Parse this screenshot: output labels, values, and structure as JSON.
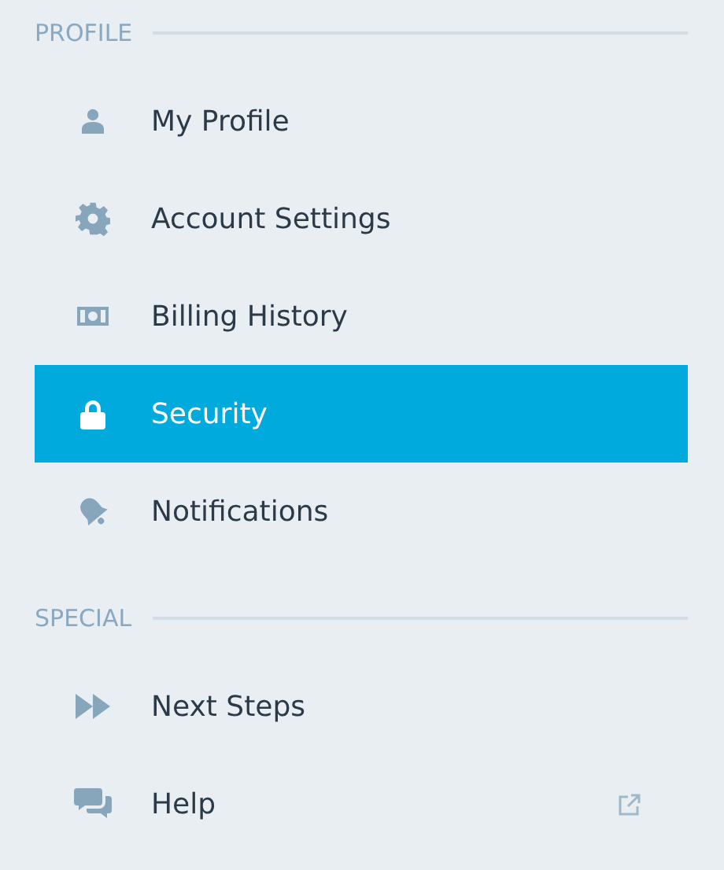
{
  "sections": [
    {
      "title": "PROFILE",
      "items": [
        {
          "label": "My Profile",
          "selected": false,
          "external": false
        },
        {
          "label": "Account Settings",
          "selected": false,
          "external": false
        },
        {
          "label": "Billing History",
          "selected": false,
          "external": false
        },
        {
          "label": "Security",
          "selected": true,
          "external": false
        },
        {
          "label": "Notifications",
          "selected": false,
          "external": false
        }
      ]
    },
    {
      "title": "SPECIAL",
      "items": [
        {
          "label": "Next Steps",
          "selected": false,
          "external": false
        },
        {
          "label": "Help",
          "selected": false,
          "external": true
        }
      ]
    }
  ]
}
